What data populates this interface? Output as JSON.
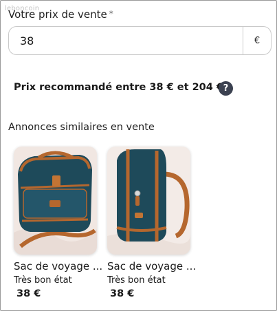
{
  "watermark": "leboncoin",
  "price_field": {
    "label": "Votre prix de vente",
    "required_mark": "*",
    "value": "38",
    "currency": "€"
  },
  "recommendation": {
    "text": "Prix recommandé entre 38 € et 204 €",
    "help_icon_glyph": "?"
  },
  "similar": {
    "title": "Annonces similaires en vente",
    "items": [
      {
        "name": "Sac de voyage ...",
        "condition": "Très bon état",
        "price": "38 €",
        "image": "blue-leather-bag-front"
      },
      {
        "name": "Sac de voyage ...",
        "condition": "Très bon état",
        "price": "38 €",
        "image": "blue-leather-bag-side"
      }
    ]
  },
  "colors": {
    "help_icon_bg": "#3b4150",
    "bag_blue": "#1e4a5a",
    "bag_leather": "#b5672e"
  }
}
